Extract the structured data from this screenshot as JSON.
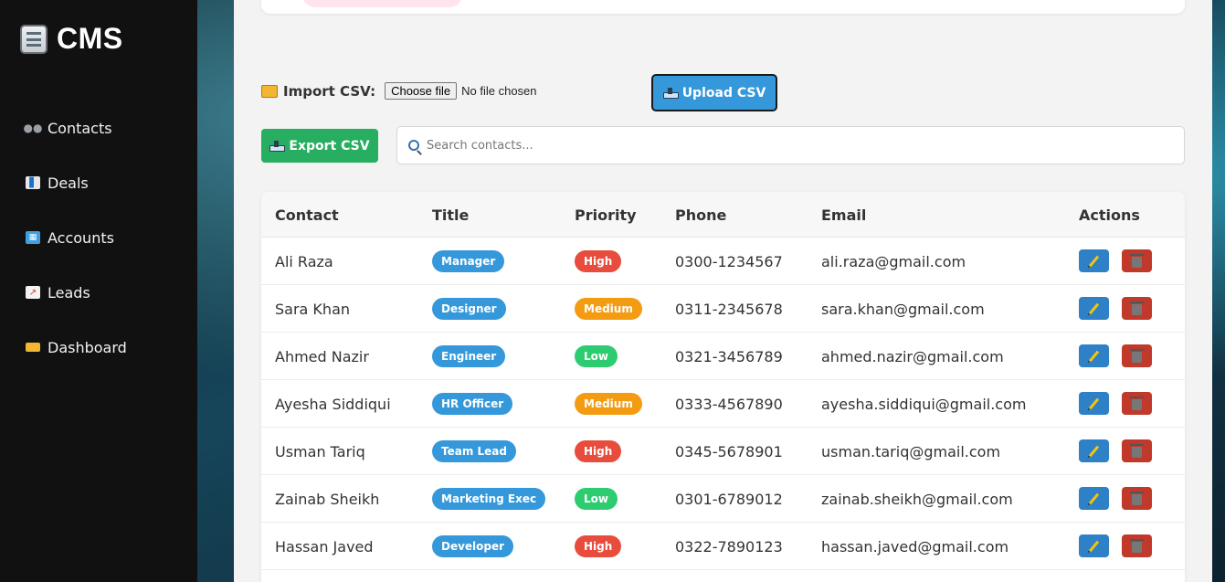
{
  "app": {
    "brand": "CMS"
  },
  "sidebar": {
    "items": [
      {
        "label": "Contacts",
        "icon": "contacts-icon"
      },
      {
        "label": "Deals",
        "icon": "bar-chart-icon"
      },
      {
        "label": "Accounts",
        "icon": "building-icon"
      },
      {
        "label": "Leads",
        "icon": "trend-up-icon"
      },
      {
        "label": "Dashboard",
        "icon": "folder-icon"
      }
    ]
  },
  "import": {
    "label": "Import CSV:",
    "choose_file": "Choose file",
    "file_status": "No file chosen",
    "upload_label": "Upload CSV"
  },
  "export": {
    "label": "Export CSV"
  },
  "search": {
    "placeholder": "Search contacts..."
  },
  "colors": {
    "sidebar_bg": "#111111",
    "upload": "#3498db",
    "export": "#27ae60",
    "title_badge": "#3498db",
    "priority_high": "#e74c3c",
    "priority_medium": "#f39c12",
    "priority_low": "#2ecc71",
    "edit": "#2e80c7",
    "delete": "#c0392b"
  },
  "table": {
    "columns": [
      "Contact",
      "Title",
      "Priority",
      "Phone",
      "Email",
      "Actions"
    ],
    "rows": [
      {
        "contact": "Ali Raza",
        "title": "Manager",
        "priority": "High",
        "phone": "0300-1234567",
        "email": "ali.raza@gmail.com"
      },
      {
        "contact": "Sara Khan",
        "title": "Designer",
        "priority": "Medium",
        "phone": "0311-2345678",
        "email": "sara.khan@gmail.com"
      },
      {
        "contact": "Ahmed Nazir",
        "title": "Engineer",
        "priority": "Low",
        "phone": "0321-3456789",
        "email": "ahmed.nazir@gmail.com"
      },
      {
        "contact": "Ayesha Siddiqui",
        "title": "HR Officer",
        "priority": "Medium",
        "phone": "0333-4567890",
        "email": "ayesha.siddiqui@gmail.com"
      },
      {
        "contact": "Usman Tariq",
        "title": "Team Lead",
        "priority": "High",
        "phone": "0345-5678901",
        "email": "usman.tariq@gmail.com"
      },
      {
        "contact": "Zainab Sheikh",
        "title": "Marketing Exec",
        "priority": "Low",
        "phone": "0301-6789012",
        "email": "zainab.sheikh@gmail.com"
      },
      {
        "contact": "Hassan Javed",
        "title": "Developer",
        "priority": "High",
        "phone": "0322-7890123",
        "email": "hassan.javed@gmail.com"
      }
    ]
  }
}
